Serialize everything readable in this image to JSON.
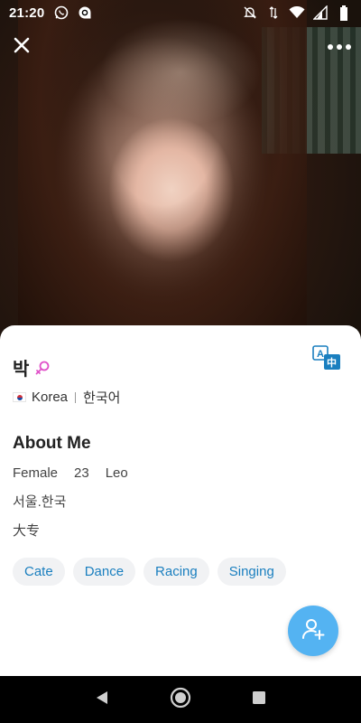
{
  "status_bar": {
    "time": "21:20",
    "left_icons": [
      "whatsapp-icon",
      "chat-bubble-icon"
    ],
    "right_icons": [
      "notifications-off-icon",
      "data-arrows-icon",
      "wifi-icon",
      "signal-icon",
      "battery-icon"
    ]
  },
  "header": {
    "close_icon": "close-icon",
    "more_icon": "more-horizontal-icon"
  },
  "profile": {
    "name": "박",
    "gender_icon": "female-symbol-icon",
    "country": "Korea",
    "language": "한국어",
    "translate_icon": "translate-icon"
  },
  "about": {
    "title": "About Me",
    "gender": "Female",
    "age": "23",
    "zodiac": "Leo",
    "city": "서울.한국",
    "education": "大专"
  },
  "interests": [
    "Cate",
    "Dance",
    "Racing",
    "Singing"
  ],
  "fab": {
    "icon": "add-friend-icon"
  },
  "nav": {
    "back_icon": "back-triangle-icon",
    "home_icon": "home-circle-icon",
    "recents_icon": "recents-square-icon"
  },
  "colors": {
    "accent": "#54b3f2",
    "tag_text": "#1a7fbf",
    "tag_bg": "#f1f2f4",
    "gender_pink": "#e052c9"
  }
}
